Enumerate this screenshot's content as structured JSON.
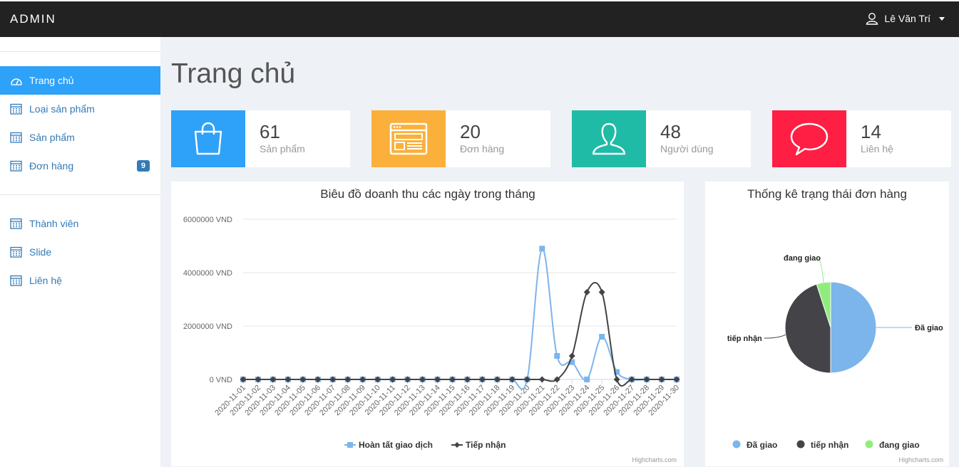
{
  "header": {
    "brand": "ADMIN",
    "user_name": "Lê Văn Trí"
  },
  "sidebar": {
    "items": [
      {
        "label": "Trang chủ",
        "active": true
      },
      {
        "label": "Loại sản phẩm"
      },
      {
        "label": "Sản phẩm"
      },
      {
        "label": "Đơn hàng",
        "badge": "9"
      },
      {
        "label": "Thành viên"
      },
      {
        "label": "Slide"
      },
      {
        "label": "Liên hệ"
      }
    ]
  },
  "page": {
    "title": "Trang chủ"
  },
  "stats": [
    {
      "value": "61",
      "label": "Sản phẩm",
      "color": "#2ea1f8",
      "icon": "shopping-bag-icon"
    },
    {
      "value": "20",
      "label": "Đơn hàng",
      "color": "#fbb03b",
      "icon": "browser-window-icon"
    },
    {
      "value": "48",
      "label": "Người dùng",
      "color": "#1fbba6",
      "icon": "user-icon"
    },
    {
      "value": "14",
      "label": "Liên hệ",
      "color": "#ff1f44",
      "icon": "speech-bubble-icon"
    }
  ],
  "credits": "Highcharts.com",
  "chart_data": [
    {
      "type": "line",
      "title": "Biêu đồ doanh thu các ngày trong tháng",
      "x": [
        "2020-11-01",
        "2020-11-02",
        "2020-11-03",
        "2020-11-04",
        "2020-11-05",
        "2020-11-06",
        "2020-11-07",
        "2020-11-08",
        "2020-11-09",
        "2020-11-10",
        "2020-11-11",
        "2020-11-12",
        "2020-11-13",
        "2020-11-14",
        "2020-11-15",
        "2020-11-16",
        "2020-11-17",
        "2020-11-18",
        "2020-11-19",
        "2020-11-20",
        "2020-11-21",
        "2020-11-22",
        "2020-11-23",
        "2020-11-24",
        "2020-11-25",
        "2020-11-26",
        "2020-11-27",
        "2020-11-28",
        "2020-11-29",
        "2020-11-30"
      ],
      "yticks": [
        "0 VND",
        "2000000 VND",
        "4000000 VND",
        "6000000 VND"
      ],
      "ylim": [
        0,
        6000000
      ],
      "grid": true,
      "legend": "bottom",
      "series": [
        {
          "name": "Hoàn tất giao dịch",
          "color": "#7cb5ec",
          "marker": "square",
          "values": [
            0,
            0,
            0,
            0,
            0,
            0,
            0,
            0,
            0,
            0,
            0,
            0,
            0,
            0,
            0,
            0,
            0,
            0,
            0,
            0,
            4900000,
            880000,
            650000,
            0,
            1600000,
            280000,
            0,
            0,
            0,
            0
          ]
        },
        {
          "name": "Tiếp nhận",
          "color": "#434348",
          "marker": "diamond",
          "values": [
            0,
            0,
            0,
            0,
            0,
            0,
            0,
            0,
            0,
            0,
            0,
            0,
            0,
            0,
            0,
            0,
            0,
            0,
            0,
            0,
            0,
            0,
            880000,
            3270000,
            3270000,
            0,
            0,
            0,
            0,
            0
          ]
        }
      ]
    },
    {
      "type": "pie",
      "title": "Thống kê trạng thái đơn hàng",
      "legend": "bottom",
      "slices": [
        {
          "name": "Đã giao",
          "value": 50,
          "color": "#7cb5ec"
        },
        {
          "name": "tiếp nhận",
          "value": 45,
          "color": "#434348"
        },
        {
          "name": "đang giao",
          "value": 5,
          "color": "#90ed7d"
        }
      ]
    }
  ]
}
